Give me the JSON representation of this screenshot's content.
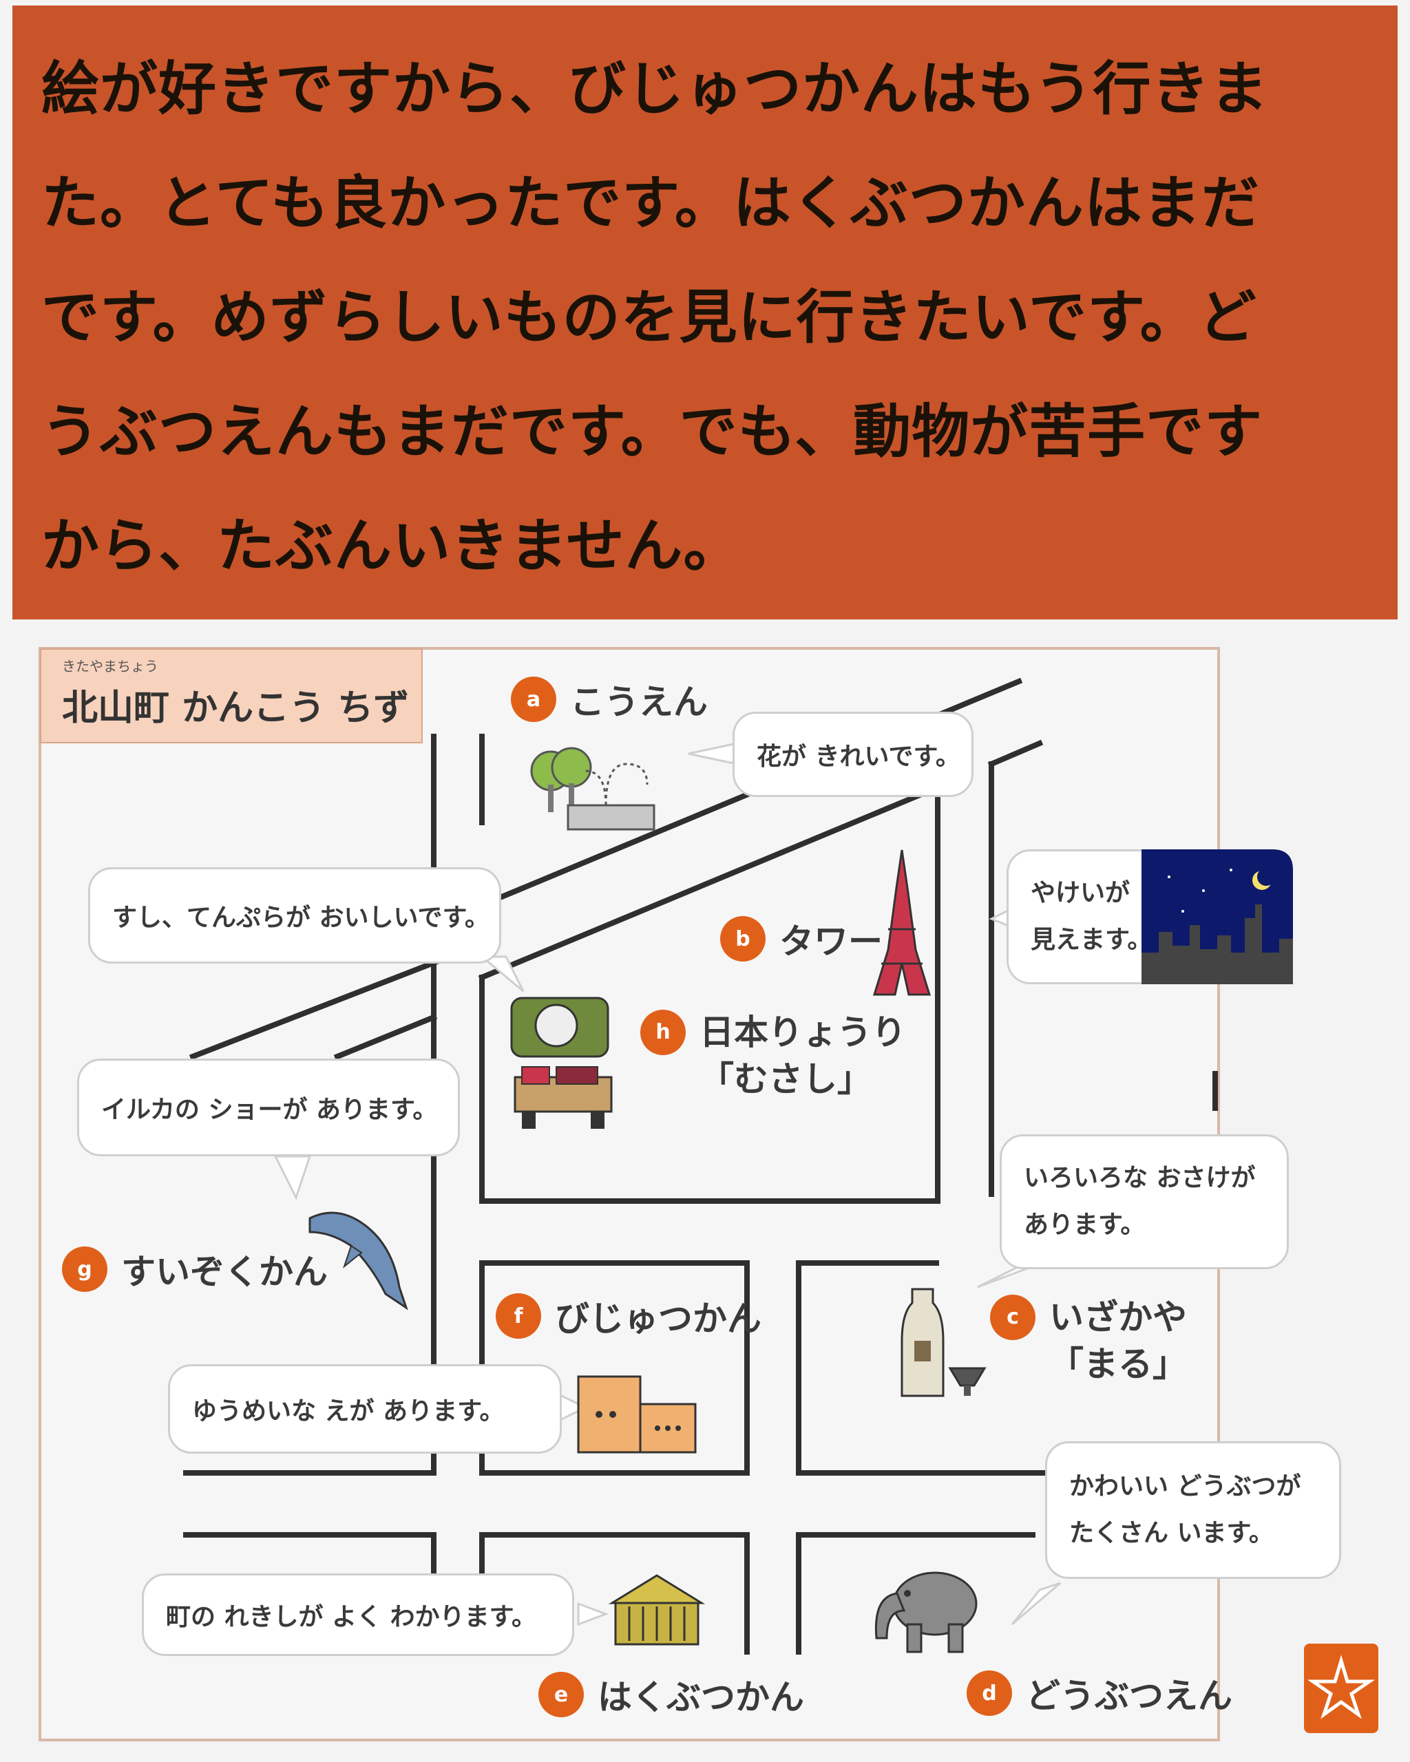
{
  "banner": {
    "lines": [
      "絵が好きですから、びじゅつかんはもう行きま",
      "た。とても良かったです。はくぶつかんはまだ",
      "です。めずらしいものを見に行きたいです。ど",
      "うぶつえんもまだです。でも、動物が苦手です",
      "から、たぶんいきません。"
    ]
  },
  "map": {
    "title_ruby": "きたやまちょう",
    "title": "北山町 かんこう ちず",
    "places": {
      "a": {
        "marker": "a",
        "name": "こうえん",
        "comment": "花が きれいです。"
      },
      "b": {
        "marker": "b",
        "name": "タワー",
        "comment_line1": "やけいが",
        "comment_line2": "見えます。"
      },
      "h": {
        "marker": "h",
        "name_line1": "日本りょうり",
        "name_line2": "「むさし」",
        "comment": "すし、てんぷらが おいしいです。"
      },
      "g": {
        "marker": "g",
        "name": "すいぞくかん",
        "comment": "イルカの ショーが あります。"
      },
      "c": {
        "marker": "c",
        "name_line1": "いざかや",
        "name_line2": "「まる」",
        "comment_line1": "いろいろな おさけが",
        "comment_line2": "あります。"
      },
      "f": {
        "marker": "f",
        "name": "びじゅつかん",
        "comment": "ゆうめいな えが あります。"
      },
      "e": {
        "marker": "e",
        "name": "はくぶつかん",
        "comment": "町の れきしが よく わかります。"
      },
      "d": {
        "marker": "d",
        "name": "どうぶつえん",
        "comment_line1": "かわいい どうぶつが",
        "comment_line2": "たくさん います。"
      }
    },
    "colors": {
      "banner": "#c9542a",
      "marker": "#e0601a",
      "road": "#2f2f2f",
      "title_bg": "#f7d2bd"
    }
  }
}
